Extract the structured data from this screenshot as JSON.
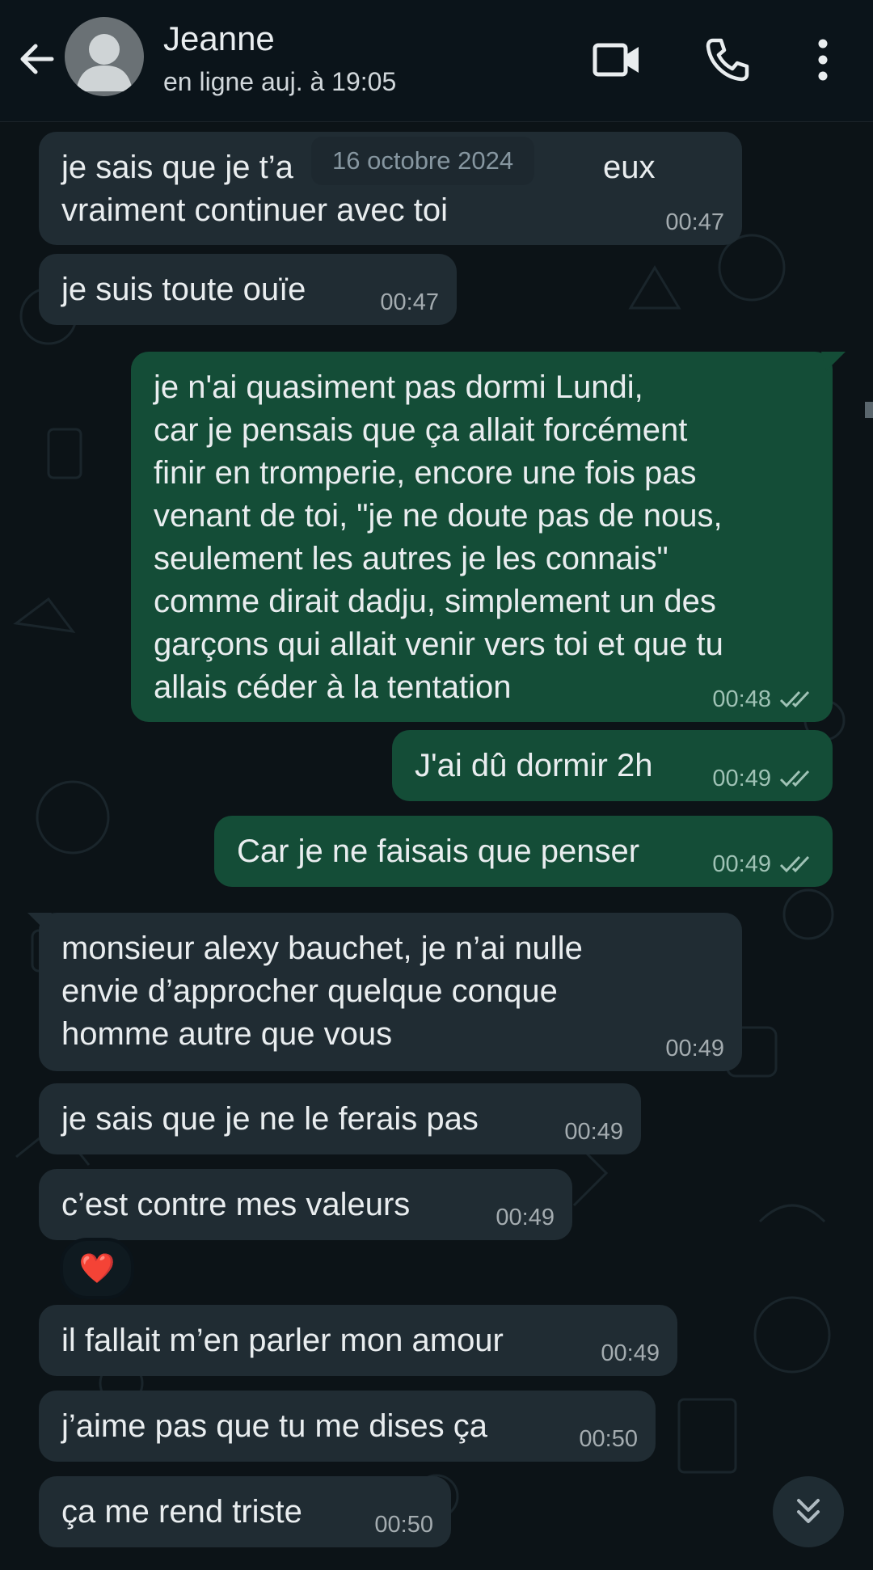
{
  "header": {
    "contact_name": "Jeanne",
    "status": "en ligne auj. à 19:05",
    "icons": {
      "back": "arrow-left-icon",
      "avatar": "default-avatar",
      "video": "video-camera-icon",
      "call": "phone-icon",
      "menu": "more-vertical-icon"
    }
  },
  "chat": {
    "date_chip": "16 octobre 2024",
    "messages": [
      {
        "id": "m1",
        "direction": "in",
        "text": "je sais que je t’a\nvraiment continuer avec toi",
        "time": "00:47"
      },
      {
        "id": "m2",
        "direction": "in",
        "text": "je suis toute ouïe",
        "time": "00:47"
      },
      {
        "id": "m3",
        "direction": "out",
        "text": "je n'ai quasiment pas dormi Lundi,\ncar je pensais que ça allait forcément\nfinir en tromperie, encore une fois pas\nvenant de toi, \"je ne doute pas de nous,\nseulement les autres je les connais\"\ncomme dirait dadju, simplement un des\ngarçons qui allait venir vers toi et que tu\nallais céder à la tentation",
        "time": "00:48",
        "read": true
      },
      {
        "id": "m4",
        "direction": "out",
        "text": "J'ai dû dormir 2h",
        "time": "00:49",
        "read": true
      },
      {
        "id": "m5",
        "direction": "out",
        "text": "Car je ne faisais que penser",
        "time": "00:49",
        "read": true
      },
      {
        "id": "m6",
        "direction": "in",
        "text": "monsieur alexy bauchet, je n’ai nulle\nenvie d’approcher quelque conque\nhomme autre que vous",
        "time": "00:49"
      },
      {
        "id": "m7",
        "direction": "in",
        "text": "je sais que je ne le ferais pas",
        "time": "00:49"
      },
      {
        "id": "m8",
        "direction": "in",
        "text": "c’est contre mes valeurs",
        "time": "00:49",
        "reaction": "❤️"
      },
      {
        "id": "m9",
        "direction": "in",
        "text": "il fallait m’en parler mon amour",
        "time": "00:49"
      },
      {
        "id": "m10",
        "direction": "in",
        "text": "j’aime pas que tu me dises ça",
        "time": "00:50"
      },
      {
        "id": "m11",
        "direction": "in",
        "text": "ça me rend triste",
        "time": "00:50"
      }
    ],
    "partial_hidden_text_tail": "eux",
    "scroll_down_icon": "double-chevron-down-icon"
  },
  "colors": {
    "background": "#0b141a",
    "incoming_bubble": "#202c33",
    "outgoing_bubble": "#144d37",
    "read_ticks": "#9fc2b5"
  }
}
